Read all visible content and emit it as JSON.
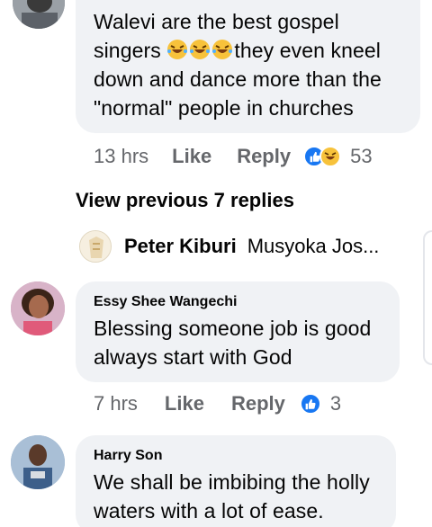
{
  "comments": [
    {
      "text_line1": "Walevi are the best gospel",
      "text_line2_pre": "singers ",
      "text_line2_post": "they even kneel",
      "text_line3": "down and dance more than the",
      "text_line4": "\"normal\" people in churches",
      "time": "13 hrs",
      "like_label": "Like",
      "reply_label": "Reply",
      "reaction_count": "53"
    },
    {
      "author": "Essy Shee Wangechi",
      "text_line1": "Blessing someone job is good",
      "text_line2": "always  start with God",
      "time": "7 hrs",
      "like_label": "Like",
      "reply_label": "Reply",
      "reaction_count": "3"
    },
    {
      "author": "Harry Son",
      "text_line1": "We shall be imbibing the holly",
      "text_line2": "waters with a lot of ease."
    }
  ],
  "view_previous": "View previous 7 replies",
  "collapsed_reply": {
    "author": "Peter Kiburi",
    "snippet": "Musyoka Jos..."
  },
  "colors": {
    "bubble": "#f0f2f5",
    "meta": "#65676b",
    "like_blue": "#1877f2",
    "haha_yellow": "#f7c23b"
  }
}
